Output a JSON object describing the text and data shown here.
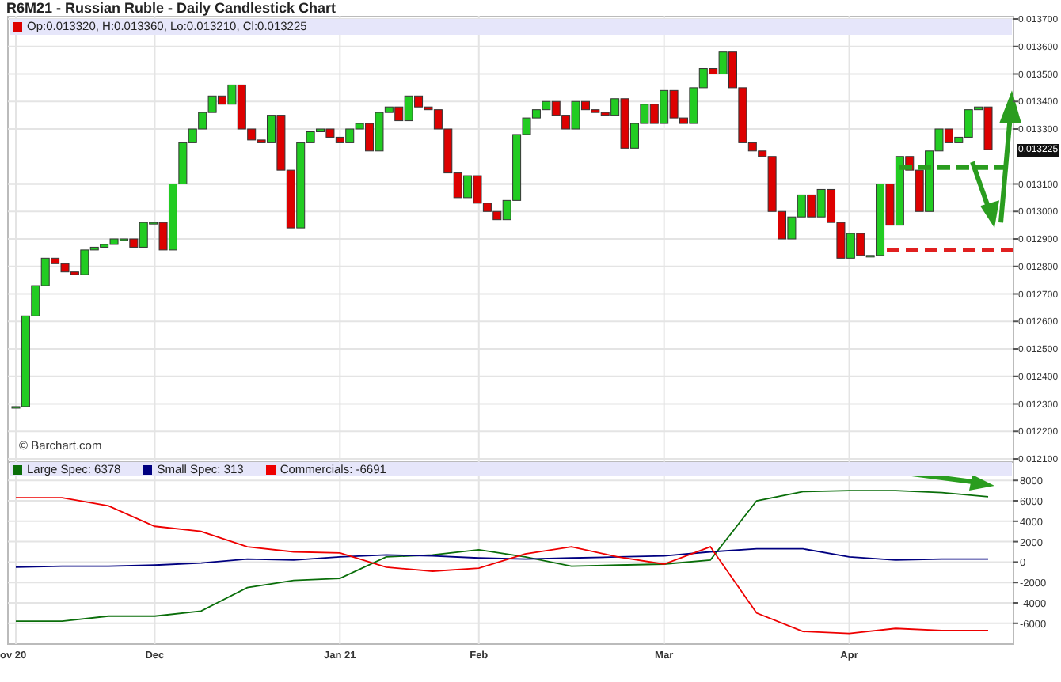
{
  "title": "R6M21 - Russian Ruble - Daily Candlestick Chart",
  "price_chart": {
    "legend": {
      "text": "Op:0.013320, H:0.013360, Lo:0.013210, Cl:0.013225",
      "color": "#dd0000"
    },
    "credit": "© Barchart.com",
    "last_price_label": "0.013225",
    "y_axis": [
      "0.013700",
      "0.013600",
      "0.013500",
      "0.013400",
      "0.013300",
      "0.013100",
      "0.013000",
      "0.012900",
      "0.012800",
      "0.012700",
      "0.012600",
      "0.012500",
      "0.012400",
      "0.012300",
      "0.012200",
      "0.012100"
    ]
  },
  "cot_chart": {
    "legend": [
      {
        "label": "Large Spec: 6378",
        "color": "#0a6e0a"
      },
      {
        "label": "Small Spec: 313",
        "color": "#000080"
      },
      {
        "label": "Commercials: -6691",
        "color": "#ee0000"
      }
    ],
    "chart_data": {
      "type": "line",
      "ylim": [
        -7800,
        9800
      ],
      "grid": true,
      "categories": [
        "ov 20",
        null,
        null,
        "Dec",
        null,
        null,
        null,
        "Jan 21",
        null,
        null,
        "Feb",
        null,
        null,
        null,
        "Mar",
        null,
        null,
        null,
        "Apr",
        null,
        null,
        null
      ],
      "series": [
        {
          "color": "#0a6e0a",
          "values": [
            -5800,
            -5800,
            -5300,
            -5300,
            -4800,
            -2500,
            -1800,
            -1600,
            500,
            700,
            1200,
            500,
            -400,
            -300,
            -200,
            200,
            6000,
            6900,
            7000,
            7000,
            6800,
            6400
          ]
        },
        {
          "color": "#000080",
          "values": [
            -500,
            -400,
            -400,
            -300,
            -100,
            300,
            200,
            500,
            700,
            600,
            400,
            300,
            400,
            500,
            600,
            1000,
            1300,
            1300,
            500,
            200,
            300,
            300
          ]
        },
        {
          "color": "#ee0000",
          "values": [
            6300,
            6300,
            5500,
            3500,
            3000,
            1500,
            1000,
            900,
            -500,
            -900,
            -600,
            800,
            1500,
            500,
            -200,
            1500,
            -5000,
            -6800,
            -7000,
            -6500,
            -6700,
            -6700
          ]
        }
      ],
      "yticks": [
        8000,
        6000,
        4000,
        2000,
        0,
        -2000,
        -4000,
        -6000
      ]
    }
  }
}
